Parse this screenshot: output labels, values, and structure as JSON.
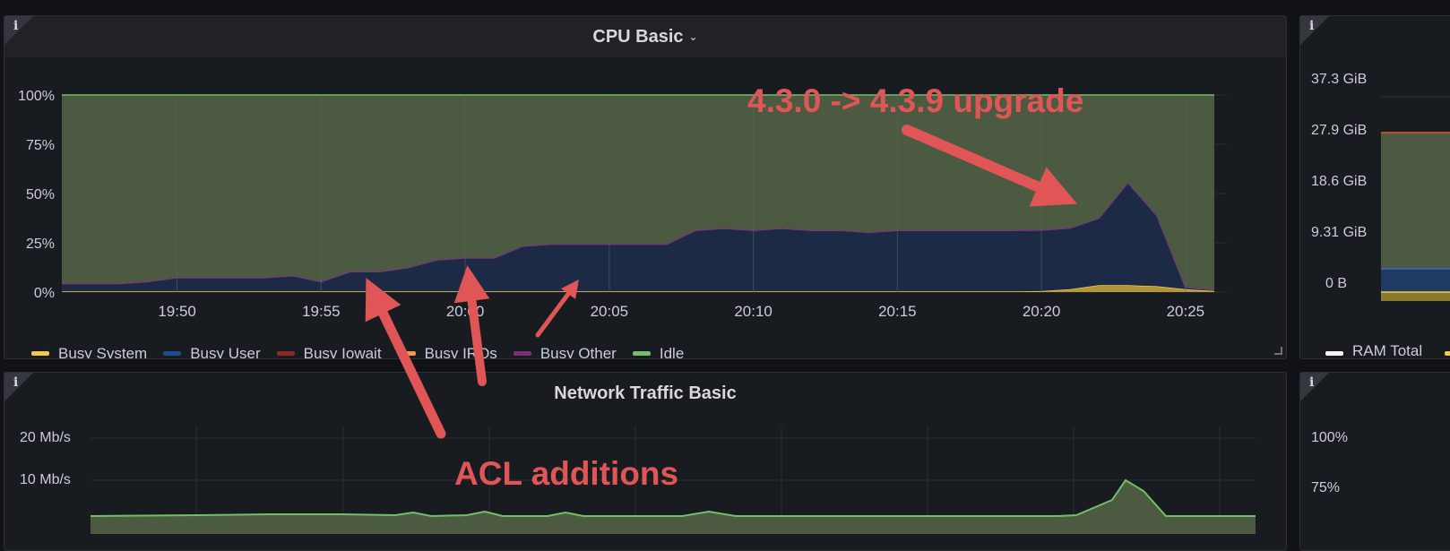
{
  "cpu_panel": {
    "title": "CPU Basic",
    "info_icon": "i",
    "legend": [
      {
        "name": "Busy System",
        "color": "#f2c94c"
      },
      {
        "name": "Busy User",
        "color": "#1f4e8f"
      },
      {
        "name": "Busy Iowait",
        "color": "#8a2a20"
      },
      {
        "name": "Busy IRQs",
        "color": "#f2994a"
      },
      {
        "name": "Busy Other",
        "color": "#7b2f7a"
      },
      {
        "name": "Idle",
        "color": "#73bf69"
      }
    ]
  },
  "memory_panel": {
    "info_icon": "i",
    "y_ticks": [
      "37.3 GiB",
      "27.9 GiB",
      "18.6 GiB",
      "9.31 GiB",
      "0 B"
    ],
    "legend_first": "RAM Total"
  },
  "network_panel": {
    "title": "Network Traffic Basic",
    "info_icon": "i",
    "y_ticks": [
      "20 Mb/s",
      "10 Mb/s"
    ]
  },
  "bottom_right_panel": {
    "info_icon": "i",
    "y_ticks": [
      "100%",
      "75%"
    ]
  },
  "annotations": {
    "upgrade": "4.3.0 -> 4.3.9 upgrade",
    "acl": "ACL additions"
  },
  "chart_data": {
    "type": "area",
    "stacked": true,
    "y_format": "percent",
    "ylim": [
      0,
      100
    ],
    "y_ticks": [
      0,
      25,
      50,
      75,
      100
    ],
    "x_tick_labels": [
      "19:50",
      "19:55",
      "20:00",
      "20:05",
      "20:10",
      "20:15",
      "20:20",
      "20:25"
    ],
    "x_minutes": [
      0,
      1,
      2,
      3,
      4,
      5,
      6,
      7,
      8,
      9,
      10,
      11,
      12,
      13,
      14,
      15,
      16,
      17,
      18,
      19,
      20,
      21,
      22,
      23,
      24,
      25,
      26,
      27,
      28,
      29,
      30,
      31,
      32,
      33,
      34,
      35,
      36,
      37,
      38,
      39,
      40
    ],
    "series": [
      {
        "name": "Busy System",
        "color": "#f2c94c",
        "values": [
          0.3,
          0.3,
          0.3,
          0.3,
          0.3,
          0.3,
          0.3,
          0.3,
          0.3,
          0.3,
          0.3,
          0.3,
          0.3,
          0.3,
          0.3,
          0.3,
          0.3,
          0.3,
          0.3,
          0.3,
          0.3,
          0.3,
          0.3,
          0.3,
          0.3,
          0.3,
          0.3,
          0.3,
          0.3,
          0.3,
          0.3,
          0.3,
          0.3,
          0.3,
          0.5,
          1.5,
          3.5,
          3.5,
          3,
          1.5,
          0.5
        ]
      },
      {
        "name": "Busy User",
        "color": "#1f3a63",
        "values": [
          4,
          4,
          4,
          5,
          7,
          7,
          7,
          7,
          8,
          5,
          10,
          10,
          12,
          16,
          17,
          17,
          23,
          24,
          24,
          24,
          24,
          24,
          31,
          32,
          31,
          32,
          31,
          31,
          30,
          31,
          31,
          31,
          31,
          31,
          31,
          31,
          34,
          52,
          36,
          1,
          0.5
        ]
      },
      {
        "name": "Busy Iowait",
        "color": "#8a2a20",
        "values": [
          0,
          0,
          0,
          0,
          0,
          0,
          0,
          0,
          0,
          0,
          0,
          0,
          0,
          0,
          0,
          0,
          0,
          0,
          0,
          0,
          0,
          0,
          0,
          0,
          0,
          0,
          0,
          0,
          0,
          0,
          0,
          0,
          0,
          0,
          0,
          0,
          0,
          0,
          0,
          0,
          0
        ]
      },
      {
        "name": "Busy IRQs",
        "color": "#f2994a",
        "values": [
          0,
          0,
          0,
          0,
          0,
          0,
          0,
          0,
          0,
          0,
          0,
          0,
          0,
          0,
          0,
          0,
          0,
          0,
          0,
          0,
          0,
          0,
          0,
          0,
          0,
          0,
          0,
          0,
          0,
          0,
          0,
          0,
          0,
          0,
          0,
          0,
          0,
          0,
          0,
          0,
          0
        ]
      },
      {
        "name": "Busy Other",
        "color": "#7b2f7a",
        "values": [
          0.2,
          0.2,
          0.2,
          0.2,
          0.2,
          0.2,
          0.2,
          0.2,
          0.2,
          0.2,
          0.2,
          0.2,
          0.2,
          0.2,
          0.2,
          0.2,
          0.2,
          0.2,
          0.2,
          0.2,
          0.2,
          0.2,
          0.2,
          0.2,
          0.2,
          0.2,
          0.2,
          0.2,
          0.2,
          0.2,
          0.2,
          0.2,
          0.2,
          0.2,
          0.2,
          0.2,
          0.2,
          0.2,
          0.2,
          0.2,
          0.2
        ]
      },
      {
        "name": "Idle",
        "color": "#73bf69",
        "values": [
          95.5,
          95.5,
          95.5,
          94.5,
          92.5,
          92.5,
          92.5,
          92.5,
          91.5,
          94.5,
          89.5,
          89.5,
          87.5,
          83.5,
          82.5,
          82.5,
          76.5,
          75.5,
          75.5,
          75.5,
          75.5,
          75.5,
          68.5,
          67.5,
          68.5,
          67.5,
          68.5,
          68.5,
          69.5,
          68.5,
          68.5,
          68.5,
          68.5,
          68.5,
          68.3,
          67.3,
          62.3,
          44.3,
          60.8,
          97.3,
          98.8
        ]
      }
    ]
  }
}
